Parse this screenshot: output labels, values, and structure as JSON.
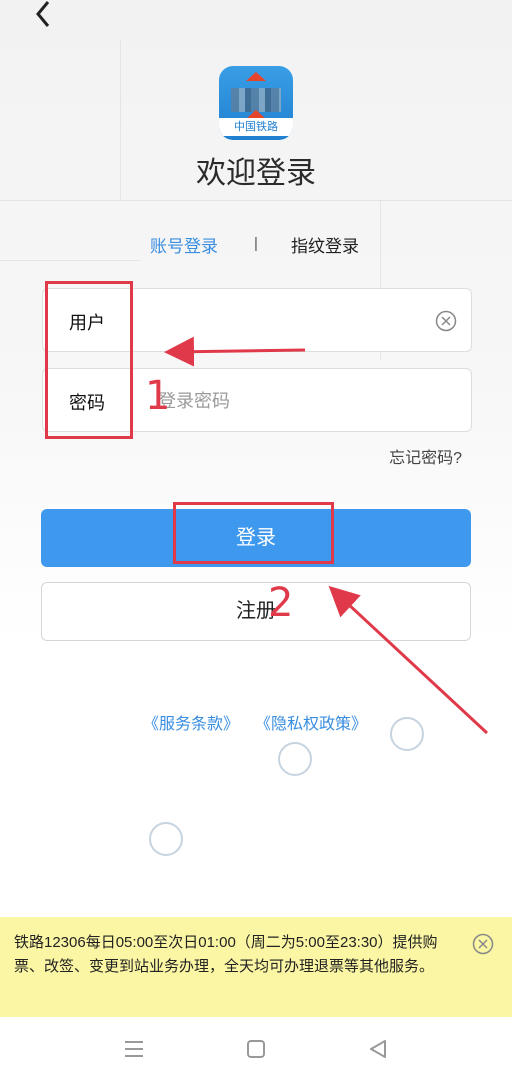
{
  "header": {
    "back_icon": "chevron-left-icon"
  },
  "app": {
    "icon_label": "中国铁路",
    "icon": "railway-app-icon"
  },
  "welcome_title": "欢迎登录",
  "tabs": {
    "account": "账号登录",
    "separator": "|",
    "fingerprint": "指纹登录"
  },
  "form": {
    "username_label": "用户",
    "username_value": "",
    "password_label": "密码",
    "password_placeholder": "登录密码",
    "clear_icon": "clear-circle-icon"
  },
  "forgot_password": "忘记密码?",
  "buttons": {
    "login": "登录",
    "register": "注册"
  },
  "terms": {
    "service": "《服务条款》",
    "privacy": "《隐私权政策》"
  },
  "notice": {
    "text": "铁路12306每日05:00至次日01:00（周二为5:00至23:30）提供购票、改签、变更到站业务办理，全天均可办理退票等其他服务。",
    "close_icon": "close-circle-icon"
  },
  "annotations": {
    "step1": "1",
    "step2": "2",
    "color": "#e03a4a"
  },
  "colors": {
    "accent": "#3e99ee",
    "notice_bg": "#faf6a4"
  },
  "system_nav": {
    "menu_icon": "menu-icon",
    "home_icon": "home-square-icon",
    "back_icon": "back-triangle-icon"
  }
}
